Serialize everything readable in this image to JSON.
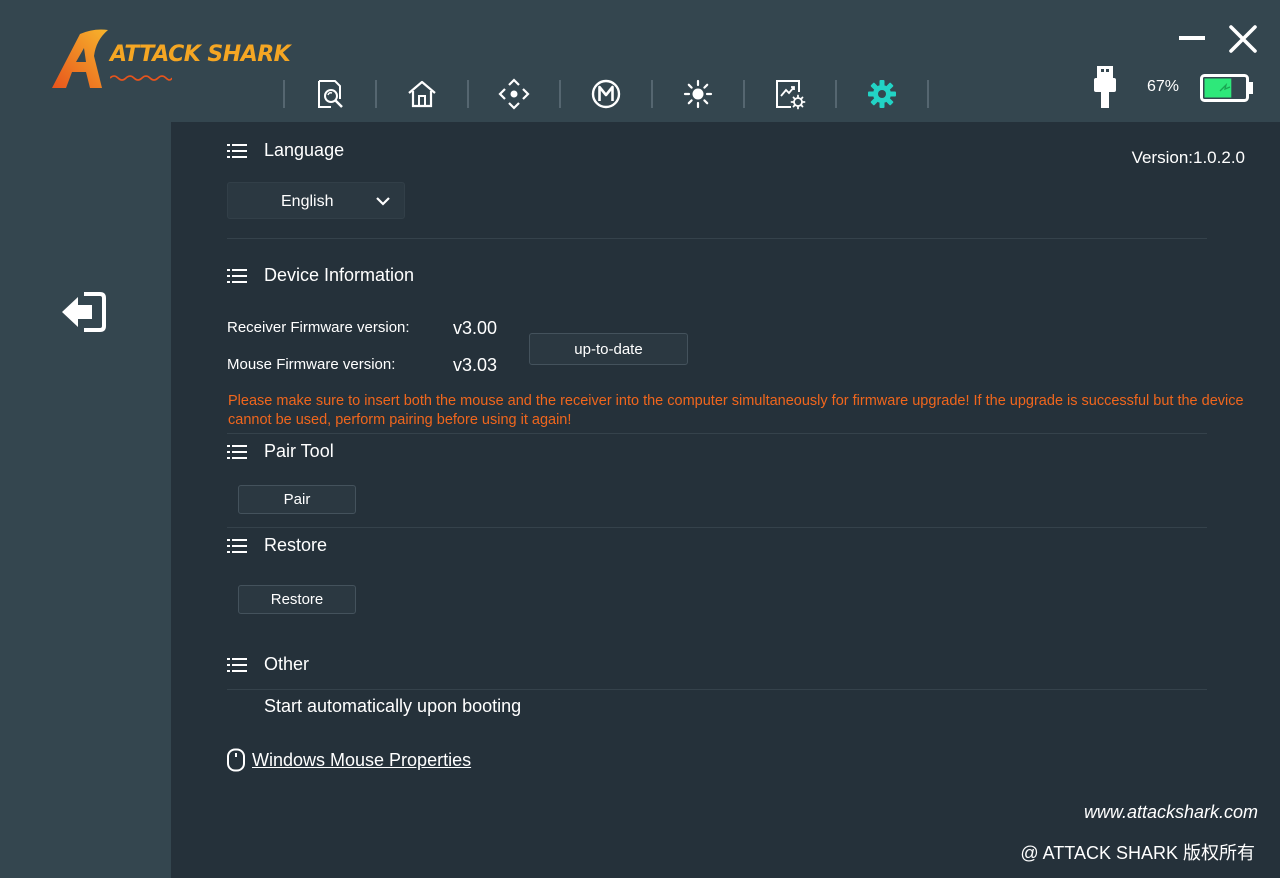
{
  "app": {
    "brand": "ATTACK SHARK"
  },
  "header": {
    "nav": [
      {
        "icon": "search-doc-icon"
      },
      {
        "icon": "home-icon"
      },
      {
        "icon": "move-arrows-icon"
      },
      {
        "icon": "macro-m-icon"
      },
      {
        "icon": "lighting-icon"
      },
      {
        "icon": "performance-settings-icon"
      },
      {
        "icon": "settings-gear-icon",
        "active": true
      }
    ],
    "battery_percent": "67%",
    "battery_level": 0.67,
    "accent_color": "#22d3c5",
    "battery_color": "#2ee87a"
  },
  "main": {
    "version": "Version:1.0.2.0",
    "language": {
      "title": "Language",
      "selected": "English"
    },
    "device_info": {
      "title": "Device Information",
      "receiver_label": "Receiver Firmware version:",
      "receiver_value": "v3.00",
      "mouse_label": "Mouse Firmware version:",
      "mouse_value": "v3.03",
      "status_button": "up-to-date",
      "warning": "Please make sure to insert both the mouse and the receiver into the computer simultaneously for firmware upgrade! If the upgrade is successful but the device cannot be used, perform pairing before using it again!",
      "warning_color": "#f0661d"
    },
    "pair_tool": {
      "title": "Pair Tool",
      "button": "Pair"
    },
    "restore": {
      "title": "Restore",
      "button": "Restore"
    },
    "other": {
      "title": "Other",
      "autostart": "Start automatically upon booting"
    },
    "mouse_properties_link": "Windows Mouse Properties"
  },
  "footer": {
    "website": "www.attackshark.com",
    "copyright": "@ ATTACK SHARK 版权所有"
  }
}
